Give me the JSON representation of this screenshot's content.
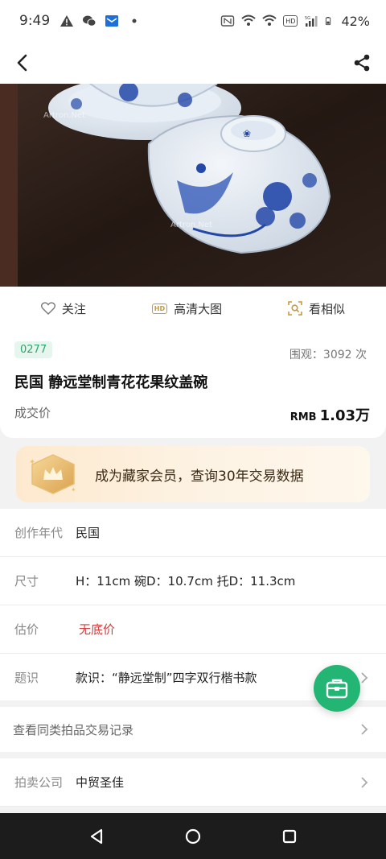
{
  "status_bar": {
    "time": "9:49",
    "battery": "42%",
    "icons": [
      "warning-icon",
      "wechat-icon",
      "mail-icon",
      "dot-icon",
      "nfc-icon",
      "wifi-icon",
      "wifi-icon",
      "hd-icon",
      "signal-icon",
      "battery-icon"
    ],
    "hd_label": "HD",
    "sig_label": "5G"
  },
  "nav": {
    "back_icon": "back-arrow-icon",
    "share_icon": "share-icon"
  },
  "hero": {
    "watermark": "Artron.Net"
  },
  "actions": {
    "follow": "关注",
    "hd": "高清大图",
    "hd_badge": "HD",
    "similar": "看相似"
  },
  "item": {
    "lot": "0277",
    "views": "围观：3092 次",
    "title": "民国 静远堂制青花花果纹盖碗",
    "deal_label": "成交价",
    "currency": "RMB",
    "price": "1.03万"
  },
  "member": {
    "text": "成为藏家会员，查询30年交易数据"
  },
  "details": [
    {
      "label": "创作年代",
      "value": "民国"
    },
    {
      "label": "尺寸",
      "value": "H：11cm 碗D：10.7cm 托D：11.3cm"
    },
    {
      "label": "估价",
      "value": "无底价"
    },
    {
      "label": "题识",
      "value": "款识：“静远堂制”四字双行楷书款"
    }
  ],
  "links": {
    "similar_records": "查看同类拍品交易记录",
    "auction_label": "拍卖公司",
    "auction_value": "中贸圣佳"
  },
  "colors": {
    "accent": "#22b573",
    "price_red": "#d23b3b",
    "badge_bg": "#e6f6ee"
  }
}
